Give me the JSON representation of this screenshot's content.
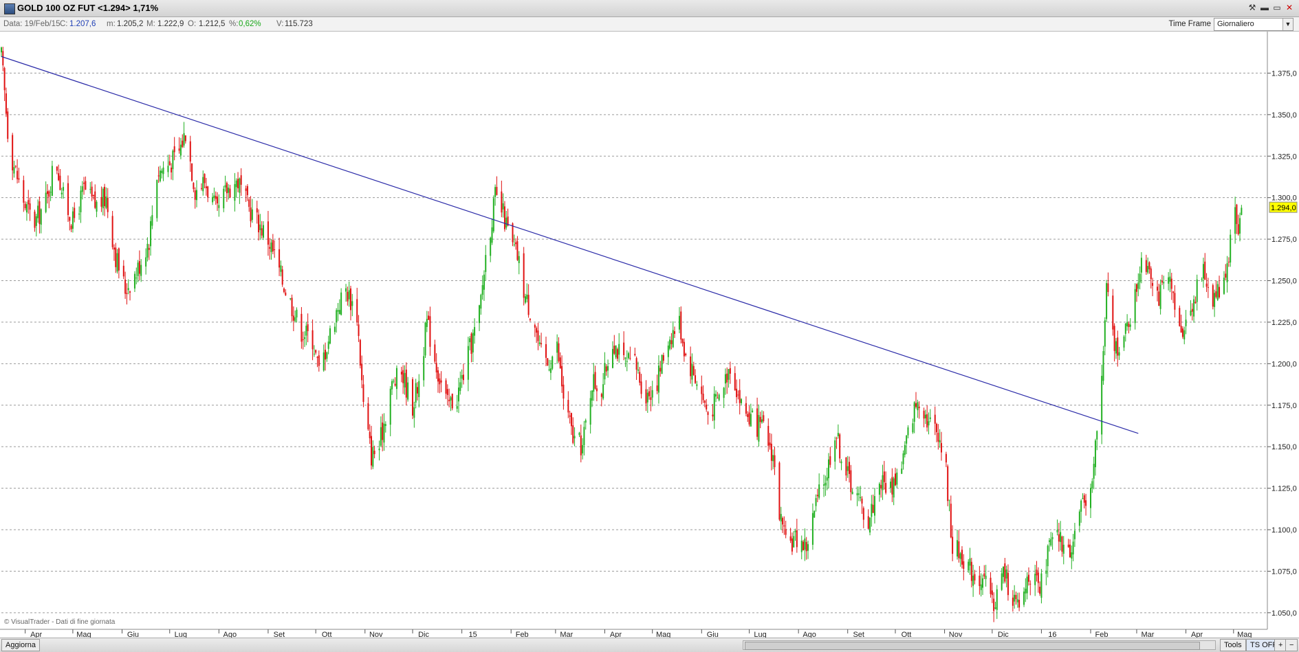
{
  "window": {
    "title": "GOLD 100 OZ FUT <1.294> 1,71%",
    "buttons": [
      "tools-icon",
      "minimize-icon",
      "maximize-icon",
      "close-icon"
    ]
  },
  "infobar": {
    "date": "Data: 19/Feb/15",
    "close_label": "C:",
    "close_value": "1.207,6",
    "min_label": "m:",
    "min_value": "1.205,2",
    "max_label": "M:",
    "max_value": "1.222,9",
    "open_label": "O:",
    "open_value": "1.212,5",
    "pct_label": "%:",
    "pct_value": "0,62%",
    "vol_label": "V:",
    "vol_value": "115.723",
    "timeframe_label": "Time Frame",
    "timeframe_value": "Giornaliero"
  },
  "bottombar": {
    "refresh_button": "Aggiorna",
    "tools_button": "Tools",
    "tsoff_button": "TS OFF",
    "plus_button": "+",
    "minus_button": "−"
  },
  "chart_data": {
    "type": "candlestick",
    "watermark": "© VisualTrader - Dati di fine giornata",
    "price_label": "1.294,0",
    "colors": {
      "up": "#22b022",
      "down": "#e01010",
      "trendline": "#2a2aa8",
      "price_label_bg": "#ffff00"
    },
    "ylim": [
      1040,
      1400
    ],
    "y_ticks": [
      {
        "value": 1050,
        "label": "1.050,0"
      },
      {
        "value": 1075,
        "label": "1.075,0"
      },
      {
        "value": 1100,
        "label": "1.100,0"
      },
      {
        "value": 1125,
        "label": "1.125,0"
      },
      {
        "value": 1150,
        "label": "1.150,0"
      },
      {
        "value": 1175,
        "label": "1.175,0"
      },
      {
        "value": 1200,
        "label": "1.200,0"
      },
      {
        "value": 1225,
        "label": "1.225,0"
      },
      {
        "value": 1250,
        "label": "1.250,0"
      },
      {
        "value": 1275,
        "label": "1.275,0"
      },
      {
        "value": 1300,
        "label": "1.300,0"
      },
      {
        "value": 1325,
        "label": "1.325,0"
      },
      {
        "value": 1350,
        "label": "1.350,0"
      },
      {
        "value": 1375,
        "label": "1.375,0"
      }
    ],
    "x_ticks": [
      {
        "date": "2014-04-01",
        "label": "Apr"
      },
      {
        "date": "2014-05-01",
        "label": "Mag"
      },
      {
        "date": "2014-06-01",
        "label": "Giu"
      },
      {
        "date": "2014-07-01",
        "label": "Lug"
      },
      {
        "date": "2014-08-01",
        "label": "Ago"
      },
      {
        "date": "2014-09-01",
        "label": "Set"
      },
      {
        "date": "2014-10-01",
        "label": "Ott"
      },
      {
        "date": "2014-11-01",
        "label": "Nov"
      },
      {
        "date": "2014-12-01",
        "label": "Dic"
      },
      {
        "date": "2015-01-01",
        "label": "15"
      },
      {
        "date": "2015-02-01",
        "label": "Feb"
      },
      {
        "date": "2015-03-01",
        "label": "Mar"
      },
      {
        "date": "2015-04-01",
        "label": "Apr"
      },
      {
        "date": "2015-05-01",
        "label": "Mag"
      },
      {
        "date": "2015-06-01",
        "label": "Giu"
      },
      {
        "date": "2015-07-01",
        "label": "Lug"
      },
      {
        "date": "2015-08-01",
        "label": "Ago"
      },
      {
        "date": "2015-09-01",
        "label": "Set"
      },
      {
        "date": "2015-10-01",
        "label": "Ott"
      },
      {
        "date": "2015-11-01",
        "label": "Nov"
      },
      {
        "date": "2015-12-01",
        "label": "Dic"
      },
      {
        "date": "2016-01-01",
        "label": "16"
      },
      {
        "date": "2016-02-01",
        "label": "Feb"
      },
      {
        "date": "2016-03-01",
        "label": "Mar"
      },
      {
        "date": "2016-04-01",
        "label": "Apr"
      },
      {
        "date": "2016-05-01",
        "label": "Mag"
      }
    ],
    "xlim": [
      "2014-03-17",
      "2016-05-21"
    ],
    "trendline": {
      "start": {
        "date": "2014-03-17",
        "value": 1385
      },
      "end": {
        "date": "2016-03-02",
        "value": 1158
      }
    },
    "close_path": [
      [
        "2014-03-17",
        1385
      ],
      [
        "2014-03-22",
        1330
      ],
      [
        "2014-04-01",
        1295
      ],
      [
        "2014-04-07",
        1285
      ],
      [
        "2014-04-15",
        1300
      ],
      [
        "2014-04-20",
        1325
      ],
      [
        "2014-04-25",
        1300
      ],
      [
        "2014-05-01",
        1285
      ],
      [
        "2014-05-08",
        1305
      ],
      [
        "2014-05-15",
        1295
      ],
      [
        "2014-05-22",
        1300
      ],
      [
        "2014-05-28",
        1265
      ],
      [
        "2014-06-03",
        1245
      ],
      [
        "2014-06-10",
        1255
      ],
      [
        "2014-06-18",
        1275
      ],
      [
        "2014-06-23",
        1315
      ],
      [
        "2014-06-30",
        1320
      ],
      [
        "2014-07-06",
        1325
      ],
      [
        "2014-07-11",
        1340
      ],
      [
        "2014-07-17",
        1305
      ],
      [
        "2014-07-23",
        1310
      ],
      [
        "2014-07-31",
        1290
      ],
      [
        "2014-08-06",
        1305
      ],
      [
        "2014-08-13",
        1310
      ],
      [
        "2014-08-19",
        1295
      ],
      [
        "2014-08-26",
        1285
      ],
      [
        "2014-09-01",
        1275
      ],
      [
        "2014-09-05",
        1265
      ],
      [
        "2014-09-10",
        1250
      ],
      [
        "2014-09-16",
        1235
      ],
      [
        "2014-09-22",
        1220
      ],
      [
        "2014-09-29",
        1215
      ],
      [
        "2014-10-03",
        1195
      ],
      [
        "2014-10-09",
        1215
      ],
      [
        "2014-10-15",
        1235
      ],
      [
        "2014-10-20",
        1245
      ],
      [
        "2014-10-27",
        1230
      ],
      [
        "2014-10-31",
        1175
      ],
      [
        "2014-11-05",
        1145
      ],
      [
        "2014-11-10",
        1150
      ],
      [
        "2014-11-17",
        1185
      ],
      [
        "2014-11-24",
        1195
      ],
      [
        "2014-12-01",
        1175
      ],
      [
        "2014-12-05",
        1190
      ],
      [
        "2014-12-10",
        1225
      ],
      [
        "2014-12-17",
        1195
      ],
      [
        "2014-12-23",
        1175
      ],
      [
        "2014-12-29",
        1180
      ],
      [
        "2015-01-05",
        1205
      ],
      [
        "2015-01-12",
        1230
      ],
      [
        "2015-01-16",
        1265
      ],
      [
        "2015-01-22",
        1300
      ],
      [
        "2015-01-27",
        1290
      ],
      [
        "2015-02-02",
        1270
      ],
      [
        "2015-02-05",
        1265
      ],
      [
        "2015-02-10",
        1240
      ],
      [
        "2015-02-16",
        1225
      ],
      [
        "2015-02-19",
        1207
      ],
      [
        "2015-02-24",
        1200
      ],
      [
        "2015-03-02",
        1210
      ],
      [
        "2015-03-06",
        1180
      ],
      [
        "2015-03-12",
        1155
      ],
      [
        "2015-03-18",
        1150
      ],
      [
        "2015-03-24",
        1190
      ],
      [
        "2015-03-30",
        1185
      ],
      [
        "2015-04-06",
        1215
      ],
      [
        "2015-04-13",
        1200
      ],
      [
        "2015-04-20",
        1200
      ],
      [
        "2015-04-27",
        1180
      ],
      [
        "2015-05-04",
        1190
      ],
      [
        "2015-05-11",
        1215
      ],
      [
        "2015-05-18",
        1225
      ],
      [
        "2015-05-22",
        1205
      ],
      [
        "2015-05-29",
        1190
      ],
      [
        "2015-06-05",
        1170
      ],
      [
        "2015-06-12",
        1180
      ],
      [
        "2015-06-19",
        1200
      ],
      [
        "2015-06-26",
        1175
      ],
      [
        "2015-07-03",
        1165
      ],
      [
        "2015-07-10",
        1160
      ],
      [
        "2015-07-16",
        1145
      ],
      [
        "2015-07-20",
        1110
      ],
      [
        "2015-07-24",
        1090
      ],
      [
        "2015-07-31",
        1095
      ],
      [
        "2015-08-06",
        1090
      ],
      [
        "2015-08-12",
        1115
      ],
      [
        "2015-08-19",
        1135
      ],
      [
        "2015-08-24",
        1160
      ],
      [
        "2015-08-31",
        1135
      ],
      [
        "2015-09-07",
        1120
      ],
      [
        "2015-09-14",
        1105
      ],
      [
        "2015-09-21",
        1130
      ],
      [
        "2015-09-28",
        1125
      ],
      [
        "2015-10-05",
        1140
      ],
      [
        "2015-10-12",
        1170
      ],
      [
        "2015-10-16",
        1180
      ],
      [
        "2015-10-22",
        1165
      ],
      [
        "2015-10-28",
        1160
      ],
      [
        "2015-11-02",
        1135
      ],
      [
        "2015-11-06",
        1090
      ],
      [
        "2015-11-12",
        1085
      ],
      [
        "2015-11-18",
        1075
      ],
      [
        "2015-11-25",
        1070
      ],
      [
        "2015-12-02",
        1055
      ],
      [
        "2015-12-08",
        1075
      ],
      [
        "2015-12-14",
        1060
      ],
      [
        "2015-12-18",
        1050
      ],
      [
        "2015-12-24",
        1075
      ],
      [
        "2015-12-31",
        1062
      ],
      [
        "2016-01-06",
        1090
      ],
      [
        "2016-01-12",
        1095
      ],
      [
        "2016-01-18",
        1085
      ],
      [
        "2016-01-25",
        1110
      ],
      [
        "2016-01-29",
        1115
      ],
      [
        "2016-02-03",
        1140
      ],
      [
        "2016-02-08",
        1190
      ],
      [
        "2016-02-11",
        1245
      ],
      [
        "2016-02-16",
        1210
      ],
      [
        "2016-02-22",
        1215
      ],
      [
        "2016-02-29",
        1240
      ],
      [
        "2016-03-04",
        1265
      ],
      [
        "2016-03-09",
        1260
      ],
      [
        "2016-03-15",
        1240
      ],
      [
        "2016-03-21",
        1250
      ],
      [
        "2016-03-28",
        1220
      ],
      [
        "2016-04-01",
        1225
      ],
      [
        "2016-04-06",
        1240
      ],
      [
        "2016-04-12",
        1255
      ],
      [
        "2016-04-18",
        1240
      ],
      [
        "2016-04-22",
        1245
      ],
      [
        "2016-04-27",
        1260
      ],
      [
        "2016-05-02",
        1295
      ],
      [
        "2016-05-04",
        1280
      ],
      [
        "2016-05-06",
        1294
      ]
    ]
  }
}
